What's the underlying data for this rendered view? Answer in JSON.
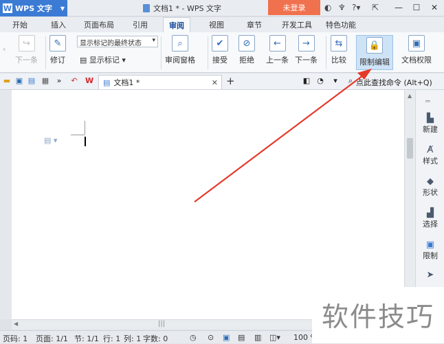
{
  "app": {
    "name": "WPS 文字",
    "doc_title": "文档1 * - WPS 文字",
    "login": "未登录"
  },
  "tabs": [
    "开始",
    "插入",
    "页面布局",
    "引用",
    "审阅",
    "视图",
    "章节",
    "开发工具",
    "特色功能"
  ],
  "ribbon": {
    "next_comment": "下一条",
    "track_changes": "修订",
    "markup_state": "显示标记的最终状态",
    "show_markup": "显示标记",
    "review_pane": "审阅窗格",
    "accept": "接受",
    "reject": "拒绝",
    "previous": "上一条",
    "next": "下一条",
    "compare": "比较",
    "restrict_editing": "限制编辑",
    "doc_permission": "文档权限"
  },
  "quickbar": {
    "doc_tab": "文档1 *",
    "find_command": "点此查找命令 (Alt+Q)"
  },
  "side": {
    "new": "新建",
    "style": "样式",
    "shape": "形状",
    "select": "选择",
    "restrict": "限制"
  },
  "status": {
    "page_no": "页码: 1",
    "pages": "页面: 1/1",
    "section": "节: 1/1",
    "row": "行: 1",
    "col": "列: 1",
    "words": "字数: 0",
    "zoom": "100 %"
  },
  "watermark": "软件技巧",
  "colors": {
    "accent": "#3b7bd4",
    "login": "#f0714e",
    "arrow": "#e43a2a"
  }
}
